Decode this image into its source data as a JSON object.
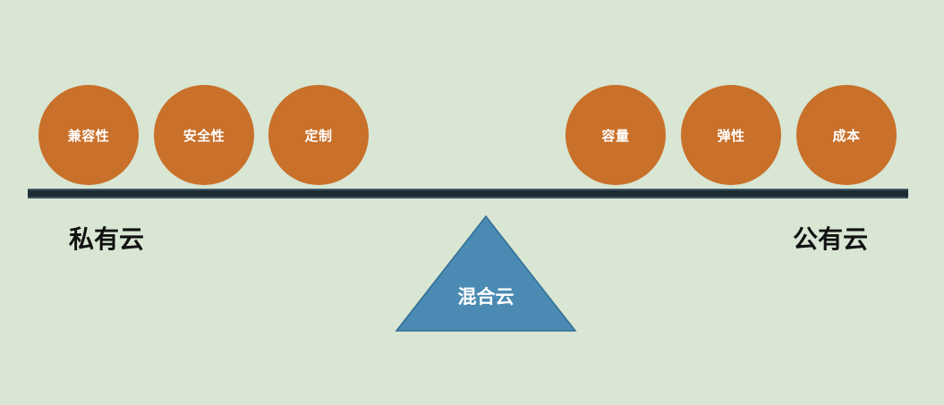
{
  "colors": {
    "background": "#d8e6d3",
    "ball": "#c9702a",
    "beam": "#1d2b34",
    "fulcrum": "#4b8bb3",
    "fulcrum_stroke": "#2f6d92"
  },
  "left": {
    "label": "私有云",
    "balls": [
      "兼容性",
      "安全性",
      "定制"
    ]
  },
  "right": {
    "label": "公有云",
    "balls": [
      "容量",
      "弹性",
      "成本"
    ]
  },
  "fulcrum": {
    "label": "混合云"
  }
}
